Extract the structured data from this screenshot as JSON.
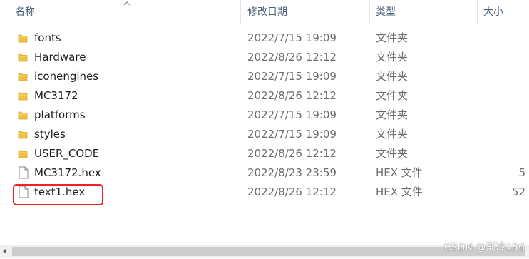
{
  "header": {
    "name": "名称",
    "date": "修改日期",
    "type": "类型",
    "size": "大小"
  },
  "rows": [
    {
      "icon": "folder-icon",
      "name": "fonts",
      "date": "2022/7/15 19:09",
      "type": "文件夹",
      "size": ""
    },
    {
      "icon": "folder-icon",
      "name": "Hardware",
      "date": "2022/8/26 12:12",
      "type": "文件夹",
      "size": ""
    },
    {
      "icon": "folder-icon",
      "name": "iconengines",
      "date": "2022/7/15 19:09",
      "type": "文件夹",
      "size": ""
    },
    {
      "icon": "folder-icon",
      "name": "MC3172",
      "date": "2022/8/26 12:12",
      "type": "文件夹",
      "size": ""
    },
    {
      "icon": "folder-icon",
      "name": "platforms",
      "date": "2022/7/15 19:09",
      "type": "文件夹",
      "size": ""
    },
    {
      "icon": "folder-icon",
      "name": "styles",
      "date": "2022/7/15 19:09",
      "type": "文件夹",
      "size": ""
    },
    {
      "icon": "folder-icon",
      "name": "USER_CODE",
      "date": "2022/8/26 12:12",
      "type": "文件夹",
      "size": ""
    },
    {
      "icon": "file-icon",
      "name": "MC3172.hex",
      "date": "2022/8/23 23:59",
      "type": "HEX 文件",
      "size": "5"
    },
    {
      "icon": "file-icon",
      "name": "text1.hex",
      "date": "2022/8/26 12:12",
      "type": "HEX 文件",
      "size": "52"
    }
  ],
  "highlight_color": "#ee2222",
  "folder_color": "#f0c040",
  "watermark": "CSDN @渐冷156"
}
